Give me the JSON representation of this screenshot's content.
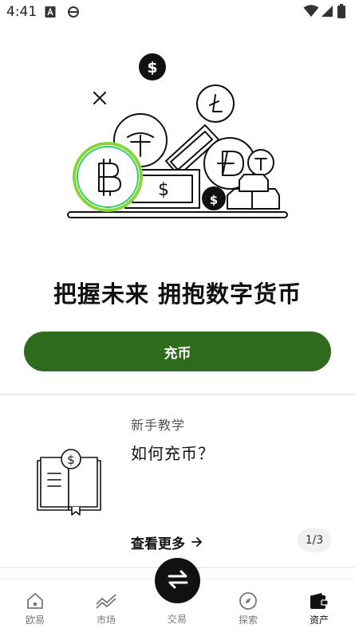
{
  "status_bar": {
    "time": "4:41",
    "left_icons": [
      "app-a-icon",
      "browser-e-icon"
    ],
    "right_icons": [
      "wifi-icon",
      "signal-icon",
      "battery-icon"
    ]
  },
  "hero": {
    "illustration": "crypto-coins-illustration"
  },
  "headline": "把握未来 拥抱数字货币",
  "deposit_button": {
    "label": "充币",
    "color": "#2e6b1c"
  },
  "tutorial_card": {
    "kicker": "新手教学",
    "title": "如何充币？",
    "view_more": "查看更多",
    "pager": "1/3",
    "icon": "book-coin-icon"
  },
  "tabbar": {
    "items": [
      {
        "label": "欧易",
        "icon": "home-icon"
      },
      {
        "label": "市场",
        "icon": "chart-icon"
      },
      {
        "label": "交易",
        "icon": "swap-icon"
      },
      {
        "label": "探索",
        "icon": "compass-icon"
      },
      {
        "label": "资产",
        "icon": "wallet-icon"
      }
    ],
    "active": "资产"
  }
}
